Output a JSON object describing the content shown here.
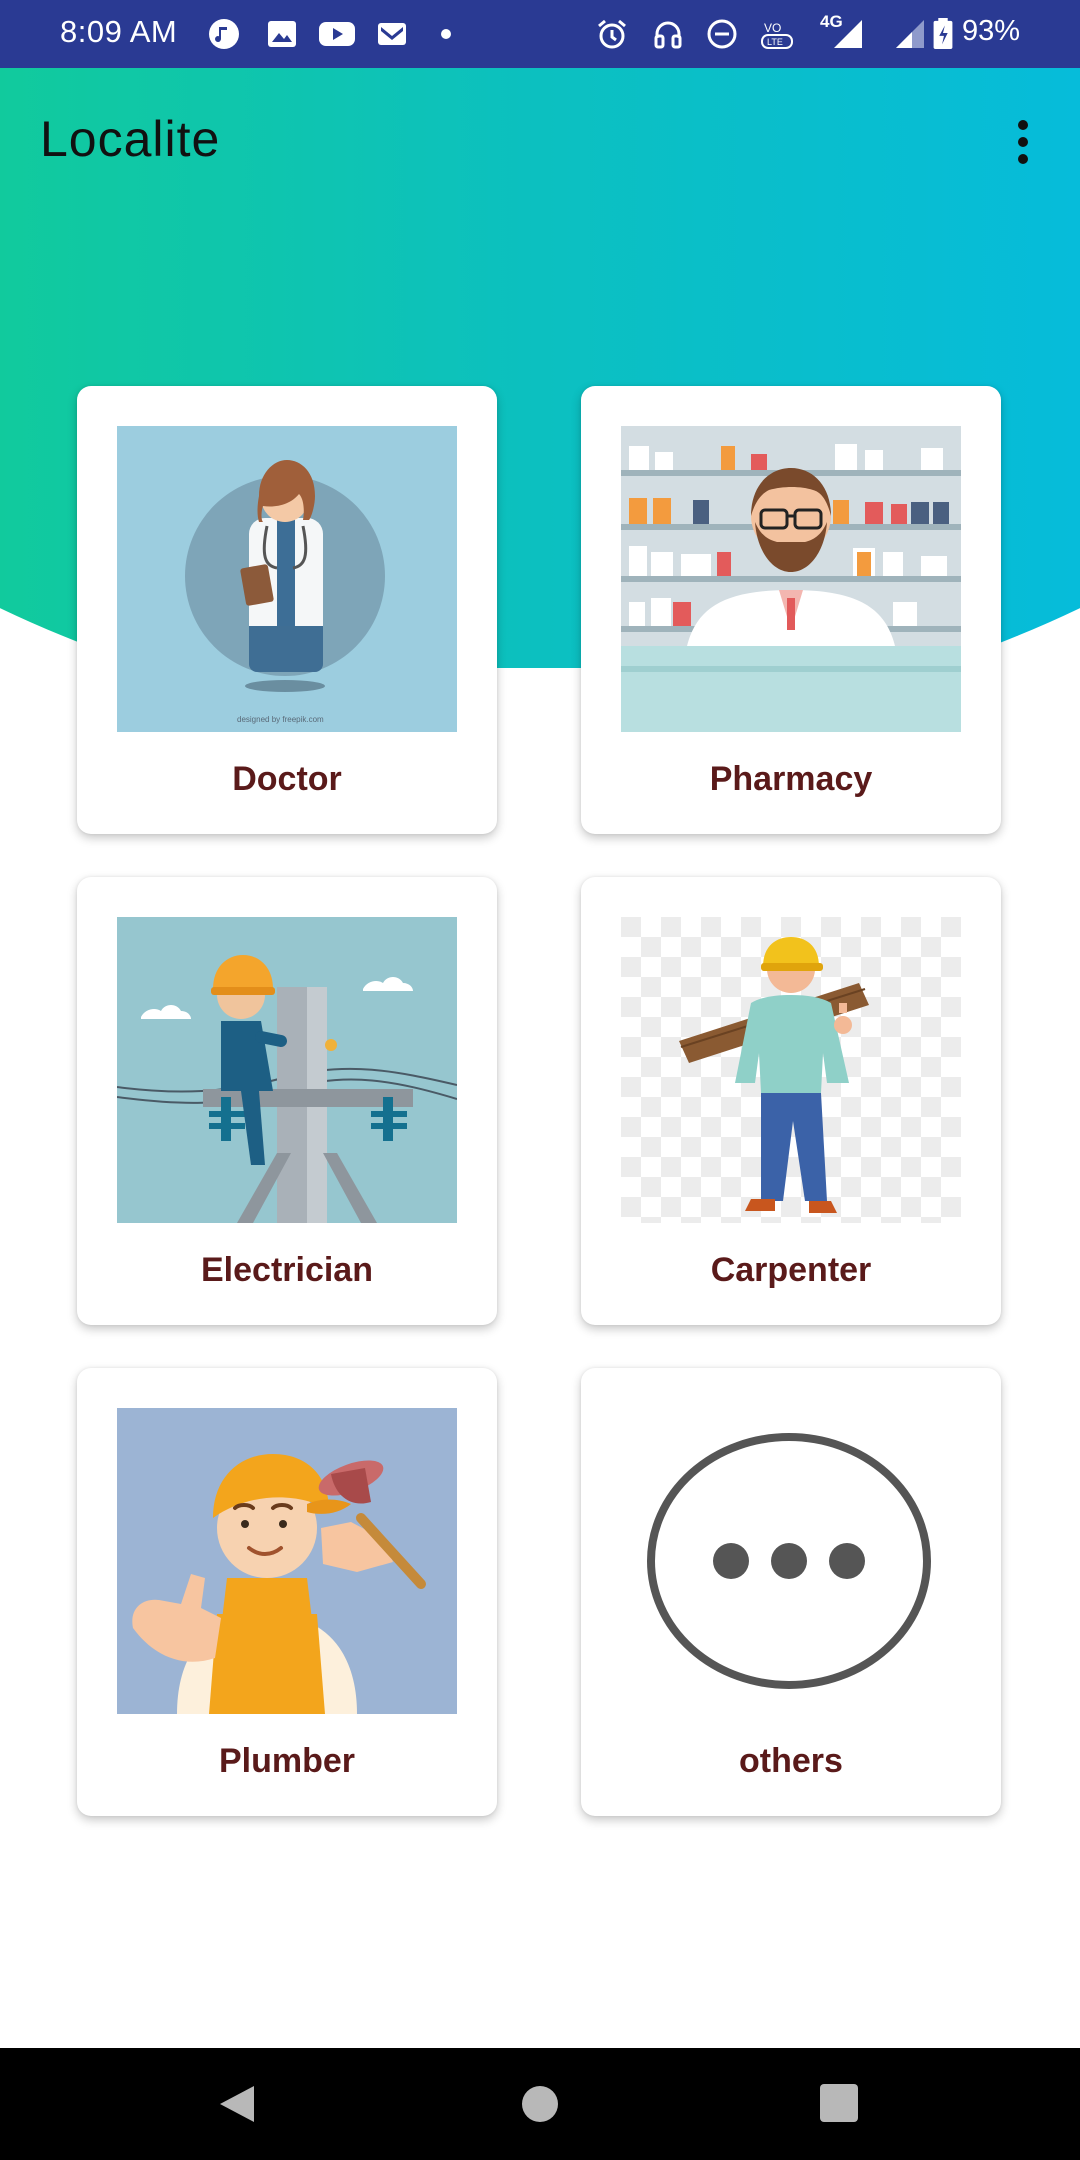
{
  "status_bar": {
    "time": "8:09 AM",
    "battery": "93%",
    "network": "4G",
    "icons": [
      "music-icon",
      "gallery-icon",
      "youtube-icon",
      "gmail-icon",
      "dot-icon",
      "alarm-icon",
      "headset-icon",
      "dnd-icon",
      "volte-icon",
      "signal-icon",
      "battery-icon"
    ]
  },
  "app_bar": {
    "title": "Localite",
    "menu_icon": "more-vert-icon"
  },
  "categories": [
    {
      "label": "Doctor",
      "image": "doctor-illustration"
    },
    {
      "label": "Pharmacy",
      "image": "pharmacist-illustration"
    },
    {
      "label": "Electrician",
      "image": "electrician-illustration"
    },
    {
      "label": "Carpenter",
      "image": "carpenter-illustration"
    },
    {
      "label": "Plumber",
      "image": "plumber-illustration"
    },
    {
      "label": "others",
      "image": "more-horizontal-icon"
    }
  ],
  "doctor_image_credit": "designed by freepik.com",
  "nav_bar": {
    "back": "back-icon",
    "home": "home-icon",
    "recents": "recents-icon"
  },
  "colors": {
    "status_bar": "#2a3a93",
    "gradient_start": "#16d47a",
    "gradient_end": "#00b8f4",
    "label": "#5a1a1a"
  }
}
